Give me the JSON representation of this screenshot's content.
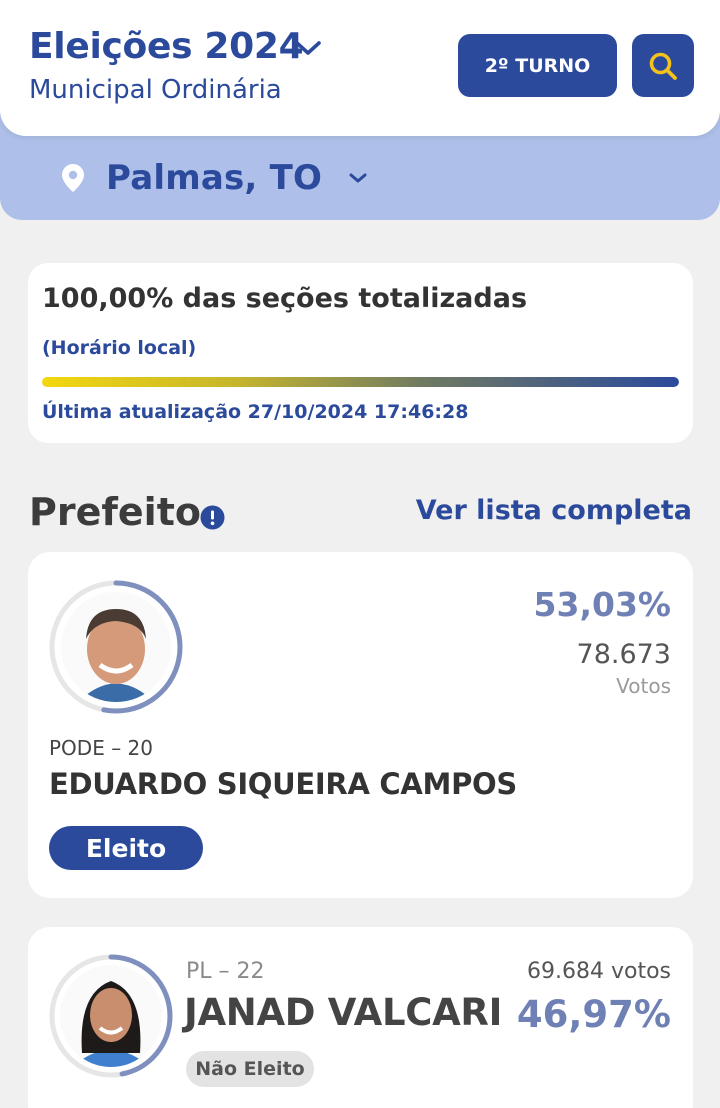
{
  "header": {
    "title": "Eleições 2024",
    "subtitle": "Municipal Ordinária",
    "turno_label": "2º TURNO",
    "search_icon": "search-icon"
  },
  "location": {
    "name": "Palmas, TO",
    "icon": "map-pin-icon"
  },
  "progress": {
    "title": "100,00% das seções totalizadas",
    "local_time_label": "(Horário local)",
    "fraction": 1.0,
    "last_update": "Última atualização 27/10/2024 17:46:28"
  },
  "section": {
    "title": "Prefeito",
    "see_all": "Ver lista completa"
  },
  "candidates": [
    {
      "party": "PODE – 20",
      "name": "EDUARDO SIQUEIRA CAMPOS",
      "percent": "53,03%",
      "votes": "78.673",
      "votes_label": "Votos",
      "status": "Eleito",
      "ring_fraction": 0.5303
    },
    {
      "party": "PL – 22",
      "name": "JANAD VALCARI",
      "percent": "46,97%",
      "votes": "69.684 votos",
      "status": "Não Eleito",
      "ring_fraction": 0.4697
    }
  ],
  "colors": {
    "primary": "#2b4a9c",
    "band": "#aec0e9",
    "percent": "#6f80b5",
    "accent": "#f3c21b"
  }
}
